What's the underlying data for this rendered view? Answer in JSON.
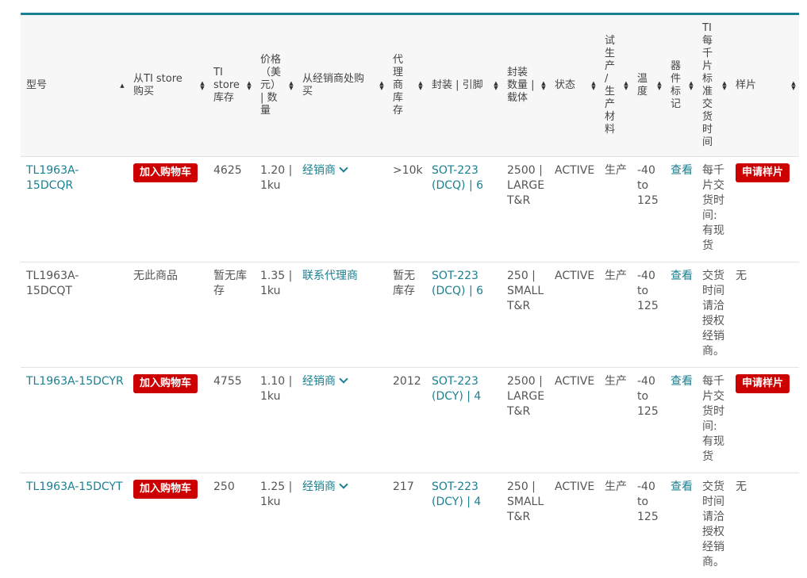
{
  "headers": [
    {
      "label": "型号",
      "sort": "up"
    },
    {
      "label": "从TI store 购买",
      "sort": "both"
    },
    {
      "label": "TI store 库存",
      "sort": "both"
    },
    {
      "label": "价格（美元）| 数量",
      "sort": "both"
    },
    {
      "label": "从经销商处购买",
      "sort": "both"
    },
    {
      "label": "代理商库存",
      "sort": "both"
    },
    {
      "label": "封装 | 引脚",
      "sort": "both"
    },
    {
      "label": "封装数量 | 载体",
      "sort": "both"
    },
    {
      "label": "状态",
      "sort": "both"
    },
    {
      "label": "试生产/生产材料",
      "sort": "both"
    },
    {
      "label": "温度",
      "sort": "both"
    },
    {
      "label": "器件标记",
      "sort": "both"
    },
    {
      "label": "TI每千片标准交货时间",
      "sort": "both"
    },
    {
      "label": "样片",
      "sort": "both"
    }
  ],
  "rows": [
    {
      "part": "TL1963A-15DCQR",
      "buy": "加入购物车",
      "stock": "4625",
      "price": "1.20 | 1ku",
      "distributor": "经销商",
      "dist_stock": ">10k",
      "package": "SOT-223 (DCQ) | 6",
      "pack_qty": "2500 | LARGE T&R",
      "status": "ACTIVE",
      "material": "生产",
      "temp": "-40 to 125",
      "marking": "查看",
      "lead_time": "每千片交货时间: 有现货",
      "sample": "申请样片"
    },
    {
      "part": "TL1963A-15DCQT",
      "buy": "无此商品",
      "stock": "暂无库存",
      "price": "1.35 | 1ku",
      "distributor": "联系代理商",
      "dist_stock": "暂无库存",
      "package": "SOT-223 (DCQ) | 6",
      "pack_qty": "250 | SMALL T&R",
      "status": "ACTIVE",
      "material": "生产",
      "temp": "-40 to 125",
      "marking": "查看",
      "lead_time": "交货时间请洽授权经销商。",
      "sample": "无"
    },
    {
      "part": "TL1963A-15DCYR",
      "buy": "加入购物车",
      "stock": "4755",
      "price": "1.10 | 1ku",
      "distributor": "经销商",
      "dist_stock": "2012",
      "package": "SOT-223 (DCY) | 4",
      "pack_qty": "2500 | LARGE T&R",
      "status": "ACTIVE",
      "material": "生产",
      "temp": "-40 to 125",
      "marking": "查看",
      "lead_time": "每千片交货时间: 有现货",
      "sample": "申请样片"
    },
    {
      "part": "TL1963A-15DCYT",
      "buy": "加入购物车",
      "stock": "250",
      "price": "1.25 | 1ku",
      "distributor": "经销商",
      "dist_stock": "217",
      "package": "SOT-223 (DCY) | 4",
      "pack_qty": "250 | SMALL T&R",
      "status": "ACTIVE",
      "material": "生产",
      "temp": "-40 to 125",
      "marking": "查看",
      "lead_time": "交货时间请洽授权经销商。",
      "sample": "无"
    }
  ],
  "colors": {
    "accent": "#1a8092",
    "button_red": "#cc0000",
    "header_bg": "#f7f7f7"
  }
}
